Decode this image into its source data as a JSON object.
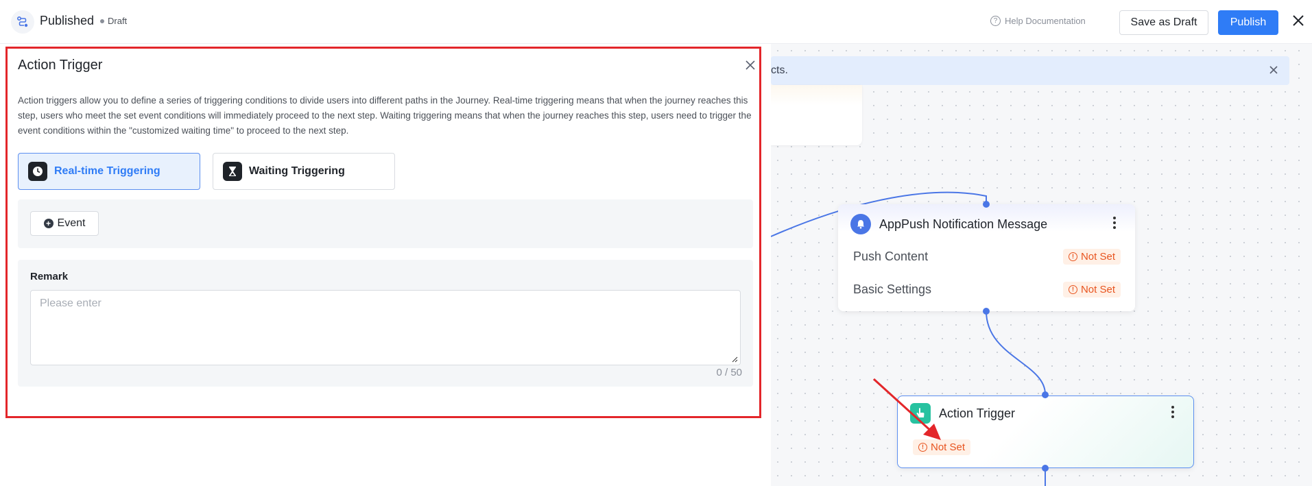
{
  "header": {
    "title": "Published",
    "status": "Draft",
    "help_label": "Help Documentation",
    "save_draft_label": "Save as Draft",
    "publish_label": "Publish"
  },
  "canvas": {
    "banner_text": "cts.",
    "push_node": {
      "title": "AppPush Notification Message",
      "rows": [
        {
          "label": "Push Content",
          "status": "Not Set"
        },
        {
          "label": "Basic Settings",
          "status": "Not Set"
        }
      ]
    },
    "trigger_node": {
      "title": "Action Trigger",
      "status": "Not Set"
    }
  },
  "drawer": {
    "title": "Action Trigger",
    "description": "Action triggers allow you to define a series of triggering conditions to divide users into different paths in the Journey. Real-time triggering means that when the journey reaches this step, users who meet the set event conditions will immediately proceed to the next step. Waiting triggering means that when the journey reaches this step, users need to trigger the event conditions within the \"customized waiting time\" to proceed to the next step.",
    "tabs": [
      {
        "label": "Real-time Triggering",
        "selected": true
      },
      {
        "label": "Waiting Triggering",
        "selected": false
      }
    ],
    "event_button": "Event",
    "remark": {
      "label": "Remark",
      "placeholder": "Please enter",
      "value": "",
      "count": "0 / 50"
    }
  },
  "colors": {
    "primary": "#2f7cf6",
    "warning": "#e8541f",
    "highlight_border": "#e3262a",
    "trigger_icon": "#27c2a0"
  },
  "icons": {
    "app_logo": "flow-icon",
    "help": "question-circle-icon",
    "close": "close-icon",
    "push": "bell-icon",
    "trigger": "hand-pointer-icon",
    "realtime": "clock-icon",
    "waiting": "hourglass-icon",
    "add": "plus-circle-icon",
    "not_set": "exclamation-circle-icon"
  }
}
